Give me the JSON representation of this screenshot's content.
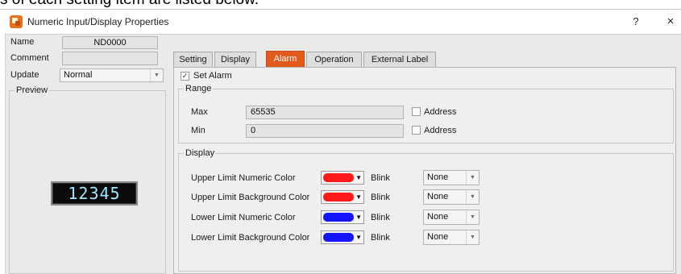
{
  "background_text": "s of each setting item are listed below.",
  "window": {
    "title": "Numeric Input/Display Properties",
    "help_glyph": "?",
    "close_glyph": "×"
  },
  "left": {
    "name_label": "Name",
    "name_value": "ND0000",
    "comment_label": "Comment",
    "comment_value": "",
    "update_label": "Update",
    "update_value": "Normal",
    "preview_label": "Preview",
    "preview_digits": "12345"
  },
  "tabs": [
    "Setting",
    "Display",
    "Alarm",
    "Operation",
    "External Label"
  ],
  "active_tab": "Alarm",
  "alarm": {
    "set_alarm_label": "Set Alarm",
    "set_alarm_checked": "✓",
    "range_label": "Range",
    "max_label": "Max",
    "max_value": "65535",
    "min_label": "Min",
    "min_value": "0",
    "address_label": "Address",
    "display_label": "Display",
    "blink_label": "Blink",
    "rows": [
      {
        "label": "Upper Limit Numeric Color",
        "color": "#ff1a1a",
        "blink": "None"
      },
      {
        "label": "Upper Limit Background Color",
        "color": "#ff1a1a",
        "blink": "None"
      },
      {
        "label": "Lower Limit Numeric Color",
        "color": "#1414ff",
        "blink": "None"
      },
      {
        "label": "Lower Limit Background Color",
        "color": "#1414ff",
        "blink": "None"
      }
    ]
  },
  "icons": {
    "dropdown": "chevron-down-icon",
    "color_caret": "triangle-down-icon",
    "checkbox": "checkmark-icon"
  }
}
